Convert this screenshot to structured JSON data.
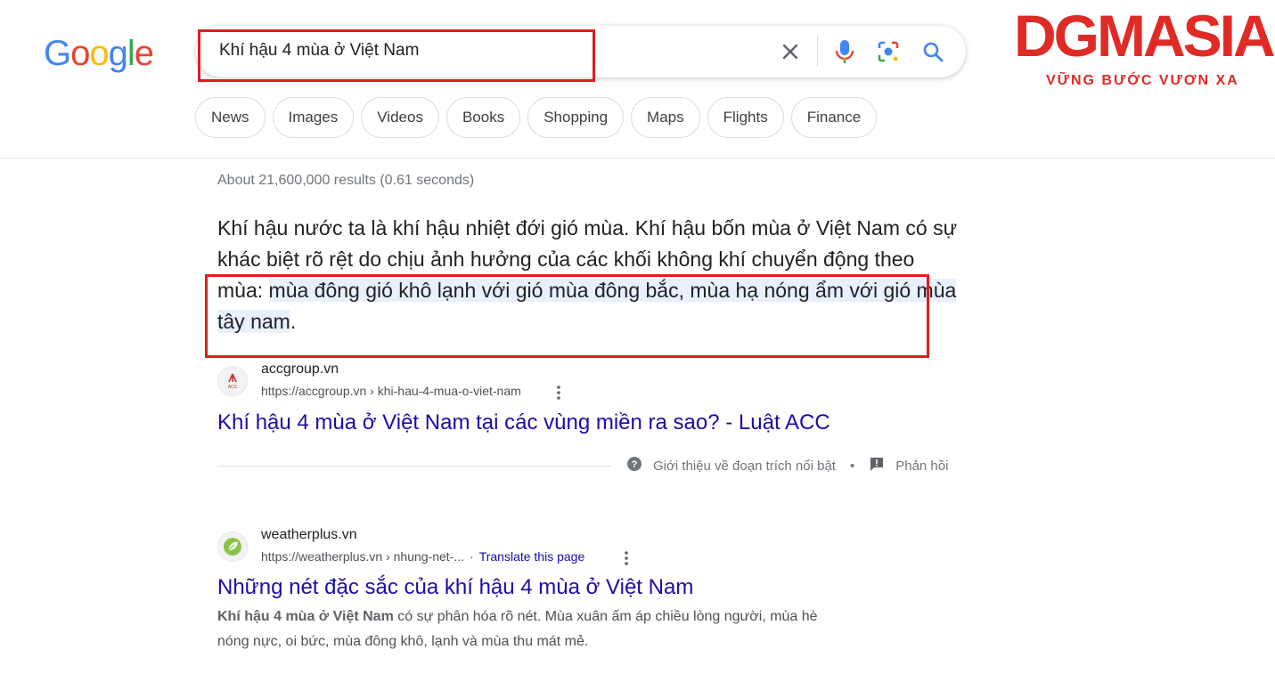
{
  "logo": {
    "letters": [
      "G",
      "o",
      "o",
      "g",
      "l",
      "e"
    ]
  },
  "search": {
    "query": "Khí hậu 4 mùa ở Việt Nam"
  },
  "chips": [
    "News",
    "Images",
    "Videos",
    "Books",
    "Shopping",
    "Maps",
    "Flights",
    "Finance"
  ],
  "stats": "About 21,600,000 results (0.61 seconds)",
  "snippet": {
    "text_plain": "Khí hậu nước ta là khí hậu nhiệt đới gió mùa. Khí hậu bốn mùa ở Việt Nam có sự khác biệt rõ rệt do chịu ảnh hưởng của các khối không khí chuyển động theo mùa: ",
    "text_highlight": "mùa đông gió khô lạnh với gió mùa đông bắc, mùa hạ nóng ẩm với gió mùa tây nam",
    "text_end": "."
  },
  "result1": {
    "site": "accgroup.vn",
    "url": "https://accgroup.vn › khi-hau-4-mua-o-viet-nam",
    "title": "Khí hậu 4 mùa ở Việt Nam tại các vùng miền ra sao? - Luật ACC",
    "favicon_text": "ACC"
  },
  "featured_footer": {
    "about": "Giới thiệu về đoạn trích nổi bật",
    "separator": "•",
    "feedback": "Phản hồi"
  },
  "result2": {
    "site": "weatherplus.vn",
    "url": "https://weatherplus.vn › nhung-net-...",
    "url_sep": "·",
    "translate": "Translate this page",
    "title": "Những nét đặc sắc của khí hậu 4 mùa ở Việt Nam",
    "desc_bold": "Khí hậu 4 mùa ở Việt Nam",
    "desc_rest_line1": " có sự phân hóa rõ nét. Mùa xuân ấm áp chiều lòng người, mùa hè",
    "desc_line2": "nóng nực, oi bức, mùa đông khô, lạnh và mùa thu mát mẻ."
  },
  "brand": {
    "name": "DGMASIA",
    "slogan": "VỮNG BƯỚC VƯƠN XA",
    "color": "#e02a25"
  },
  "colors": {
    "link": "#1a0dab",
    "highlight": "#e8f0fe",
    "annotation_red": "#e01d1d"
  }
}
